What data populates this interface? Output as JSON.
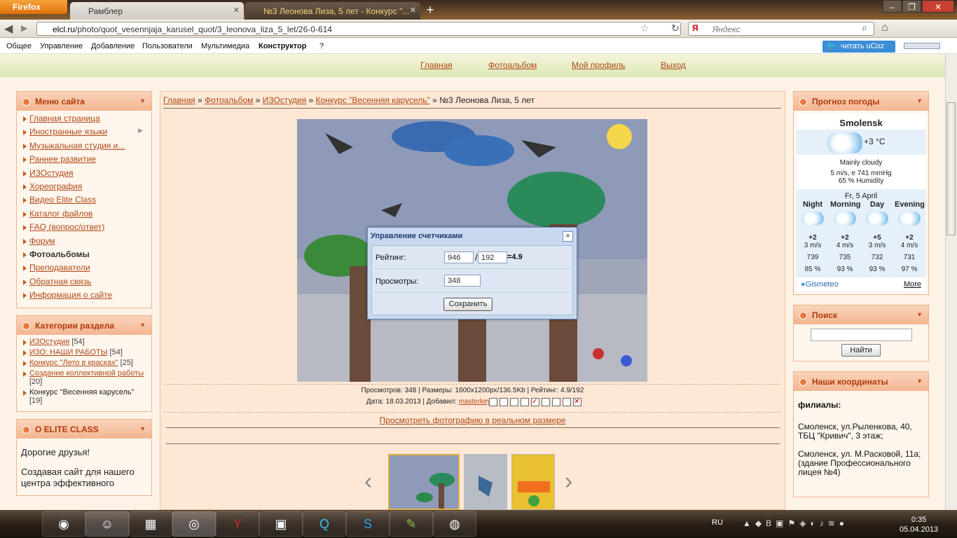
{
  "browser": {
    "brand": "Firefox",
    "tabs": [
      {
        "title": "Рамблер"
      },
      {
        "title": "№3 Леонова Лиза, 5 лет - Конкурс \"..."
      }
    ],
    "url_domain": "elcl.ru",
    "url_path": "/photo/quot_vesennjaja_karusel_quot/3_leonova_liza_5_let/26-0-614",
    "search_placeholder": "Яндекс"
  },
  "ucoz": {
    "menu": [
      "Общее",
      "Управление",
      "Добавление",
      "Пользователи",
      "Мультимедиа",
      "Конструктор",
      "?"
    ],
    "twitter": "читать uCoz"
  },
  "header_nav": [
    "Главная",
    "Фотоальбом",
    "Мой профиль",
    "Выход"
  ],
  "left": {
    "menu_title": "Меню сайта",
    "menu": [
      "Главная страница",
      "Иностранные языки",
      "Музыкальная студия и...",
      "Раннее развитие",
      "ИЗОстудия",
      "Хореография",
      "Видео Elite Class",
      "Каталог файлов",
      "FAQ (вопрос/ответ)",
      "Форум",
      "Фотоальбомы",
      "Преподаватели",
      "Обратная связь",
      "Информация о сайте"
    ],
    "cat_title": "Категории раздела",
    "cats": [
      {
        "name": "ИЗОстудия",
        "count": "[54]"
      },
      {
        "name": "ИЗО: НАШИ РАБОТЫ",
        "count": "[54]"
      },
      {
        "name": "Конкурс \"Лето в красках\"",
        "count": "[25]"
      },
      {
        "name": "Создание коллективной работы",
        "count": "[20]"
      },
      {
        "name": "Конкурс \"Весенняя карусель\"",
        "count": "[19]"
      }
    ],
    "about_title": "О ELITE CLASS",
    "about_text1": "Дорогие друзья!",
    "about_text2": "Создавая сайт для нашего центра эффективного"
  },
  "crumbs": {
    "c1": "Главная",
    "c2": "Фотоальбом",
    "c3": "ИЗОстудия",
    "c4": "Конкурс \"Весенняя карусель\"",
    "current": "№3 Леонова Лиза, 5 лет",
    "sep": "»"
  },
  "photo_meta": {
    "line1": "Просмотров: 348 | Размеры: 1600x1200px/136.5Kb | Рейтинг: 4.9/192",
    "date": "Дата: 18.03.2013 | Добавил:",
    "author": "masterkey",
    "realsize": "Просмотреть фотографию в реальном размере"
  },
  "dialog": {
    "title": "Управление счетчиками",
    "rating_label": "Рейтинг:",
    "rating_sum": "946",
    "slash": "/",
    "rating_votes": "192",
    "rating_result": "=4.9",
    "views_label": "Просмотры:",
    "views": "348",
    "save": "Сохранить",
    "close": "×"
  },
  "weather": {
    "title": "Прогноз погоды",
    "city": "Smolensk",
    "temp": "+3 °C",
    "desc": "Mainly cloudy",
    "wind": "5 m/s, e  741 mmHg",
    "humidity": "65 % Humidity",
    "date": "Fr, 5 April",
    "periods": [
      {
        "name": "Night",
        "t": "+2",
        "w": "3 m/s",
        "p": "739",
        "h": "85 %"
      },
      {
        "name": "Morning",
        "t": "+2",
        "w": "4 m/s",
        "p": "735",
        "h": "93 %"
      },
      {
        "name": "Day",
        "t": "+5",
        "w": "3 m/s",
        "p": "732",
        "h": "93 %"
      },
      {
        "name": "Evening",
        "t": "+2",
        "w": "4 m/s",
        "p": "731",
        "h": "97 %"
      }
    ],
    "brand": "Gismeteo",
    "more": "More"
  },
  "search": {
    "title": "Поиск",
    "button": "Найти"
  },
  "coords": {
    "title": "Наши координаты",
    "heading": "филиалы:",
    "addr1": "Смоленск, ул.Рыленкова, 40, ТБЦ \"Кривич\", 3 этаж;",
    "addr2": "Смоленск, ул. М.Расковой, 11а;",
    "addr3": "(здание Профессионального лицея №4)"
  },
  "taskbar": {
    "lang": "RU",
    "time": "0:35",
    "date": "05.04.2013"
  },
  "colors": {
    "accent": "#b04a17",
    "box_header": "#f3b590",
    "dialog": "#c8d8ee"
  }
}
